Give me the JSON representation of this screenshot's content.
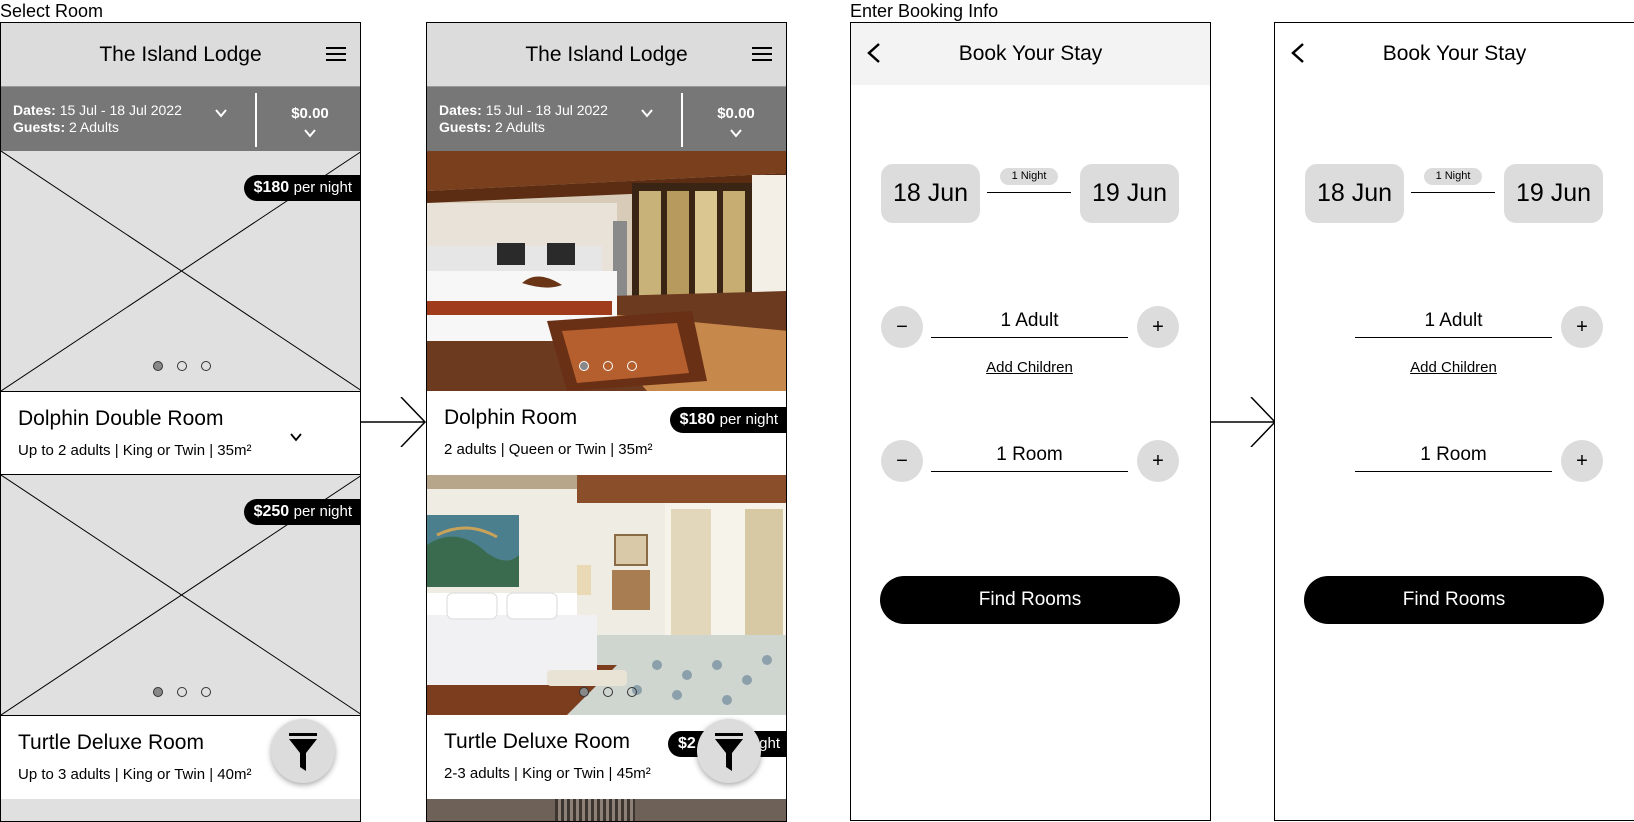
{
  "labels": {
    "select_room": "Select Room",
    "enter_booking_info": "Enter Booking Info"
  },
  "room_list": {
    "hotel_name": "The Island Lodge",
    "dates_label": "Dates:",
    "dates_value": "15 Jul - 18 Jul 2022",
    "guests_label": "Guests:",
    "guests_value": "2 Adults",
    "total_price": "$0.00",
    "per_night": "per night"
  },
  "wireframe": {
    "rooms": [
      {
        "name": "Dolphin Double Room",
        "meta": "Up to 2 adults | King or Twin | 35m²",
        "price": "$180"
      },
      {
        "name": "Turtle Deluxe Room",
        "meta": "Up to 3 adults | King or Twin | 40m²",
        "price": "$250"
      }
    ]
  },
  "mockup": {
    "rooms": [
      {
        "name": "Dolphin Room",
        "meta": "2 adults | Queen or Twin | 35m²",
        "price": "$180"
      },
      {
        "name": "Turtle Deluxe Room",
        "meta": "2-3 adults | King or Twin | 45m²",
        "price": "$2"
      }
    ],
    "partial_tag_suffix": "ght"
  },
  "booking": {
    "title": "Book Your Stay",
    "check_in": "18 Jun",
    "check_out": "19 Jun",
    "nights": "1 Night",
    "adults": "1 Adult",
    "add_children": "Add Children",
    "rooms": "1 Room",
    "minus": "−",
    "plus": "+",
    "cta": "Find Rooms"
  },
  "icons": [
    "menu-icon",
    "chevron-down-icon",
    "filter-icon",
    "back-arrow-icon",
    "arrow-right-icon",
    "image-placeholder-icon"
  ],
  "colors": {
    "header_bg": "#dcdcdc",
    "filter_bar_bg": "#777777",
    "placeholder_bg": "#e0e0e0",
    "button_bg": "#000000"
  }
}
